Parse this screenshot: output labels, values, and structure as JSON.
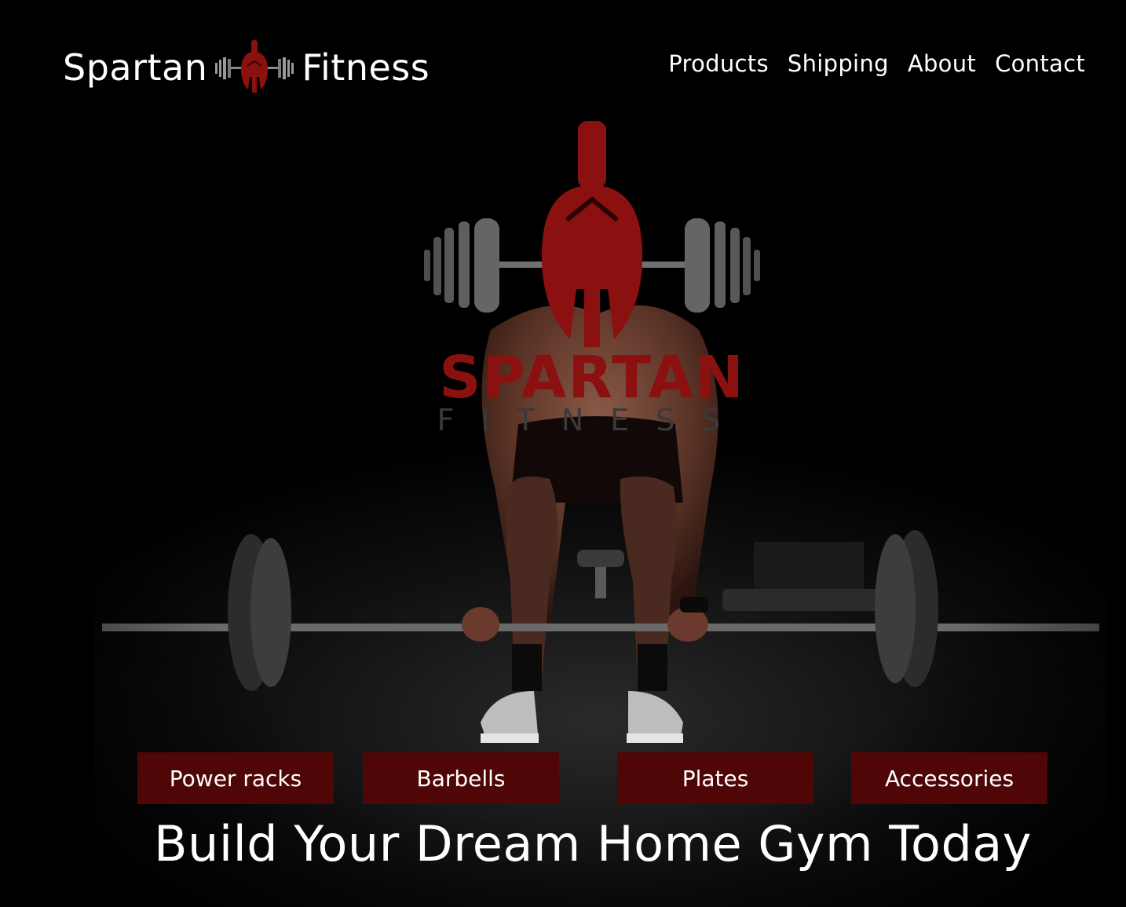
{
  "header": {
    "brand": {
      "word_left": "Spartan",
      "word_right": "Fitness",
      "icon": "spartan-helmet-barbell-icon"
    },
    "nav": [
      {
        "label": "Products"
      },
      {
        "label": "Shipping"
      },
      {
        "label": "About"
      },
      {
        "label": "Contact"
      }
    ]
  },
  "hero": {
    "logo": {
      "title": "SPARTAN",
      "subtitle": "FITNESS"
    },
    "categories": [
      {
        "label": "Power racks"
      },
      {
        "label": "Barbells"
      },
      {
        "label": "Plates"
      },
      {
        "label": "Accessories"
      }
    ],
    "tagline": "Build Your Dream Home Gym Today"
  },
  "colors": {
    "background": "#000000",
    "accent": "#4f0606",
    "logo_red": "#8b1010",
    "text": "#ffffff"
  }
}
